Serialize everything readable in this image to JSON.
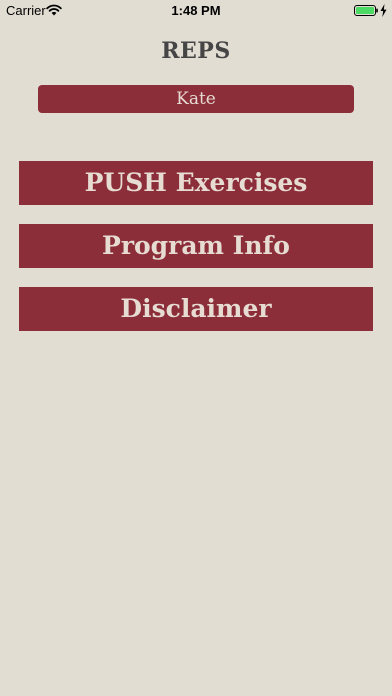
{
  "status_bar": {
    "carrier": "Carrier",
    "time": "1:48 PM",
    "icons": [
      "wifi-icon",
      "battery-icon",
      "charging-icon"
    ]
  },
  "app": {
    "title": "REPS",
    "user_name": "Kate"
  },
  "menu": {
    "items": [
      {
        "label": "PUSH Exercises"
      },
      {
        "label": "Program Info"
      },
      {
        "label": "Disclaimer"
      }
    ]
  },
  "colors": {
    "background": "#e1ddd3",
    "accent": "#8c2e3a",
    "button_text": "#e6dcd2",
    "title_text": "#454545"
  }
}
